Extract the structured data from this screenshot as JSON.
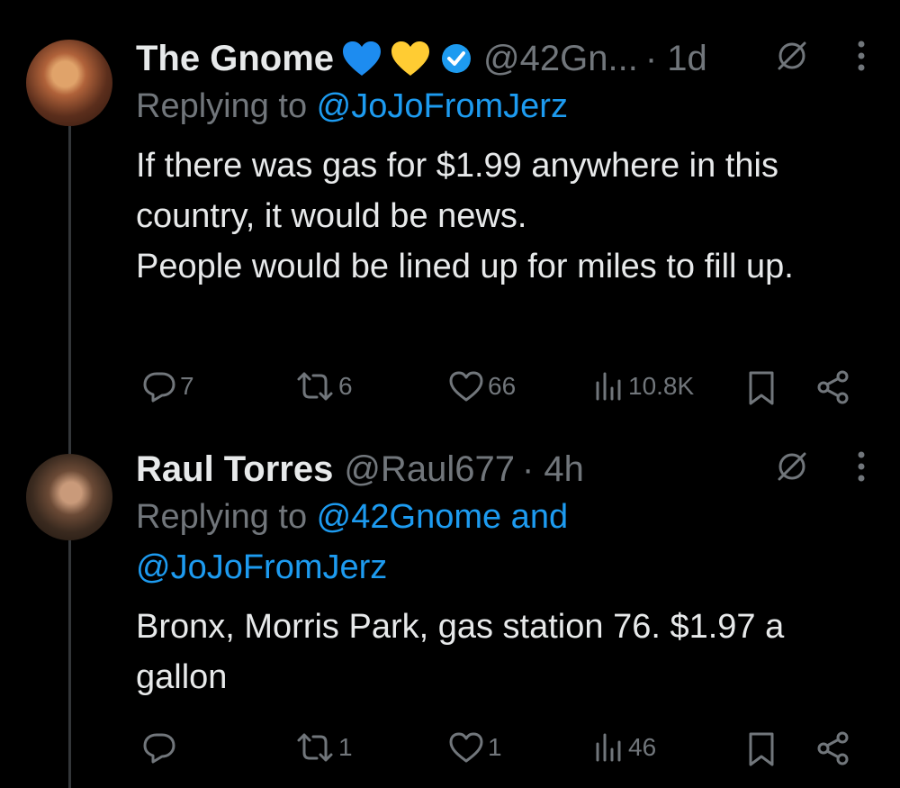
{
  "colors": {
    "background": "#000000",
    "text": "#e7e9ea",
    "muted": "#71767b",
    "link": "#1d9bf0",
    "verified": "#1d9bf0"
  },
  "tweets": [
    {
      "name": "The Gnome",
      "emoji": [
        "blue-heart",
        "yellow-heart"
      ],
      "verified": true,
      "handle": "@42Gn...",
      "time": "· 1d",
      "replying_prefix": "Replying to ",
      "replying_to": "@JoJoFromJerz",
      "text": "If there was gas for $1.99 anywhere in this country, it would be news.\nPeople would be lined up for miles to fill up.",
      "stats": {
        "replies": "7",
        "reposts": "6",
        "likes": "66",
        "views": "10.8K"
      }
    },
    {
      "name": "Raul Torres",
      "handle": "@Raul677",
      "time": "· 4h",
      "replying_prefix": "Replying to ",
      "replying_to": "@42Gnome and @JoJoFromJerz",
      "text": "Bronx, Morris Park, gas station 76. $1.97 a gallon",
      "stats": {
        "replies": "",
        "reposts": "1",
        "likes": "1",
        "views": "46"
      }
    }
  ]
}
